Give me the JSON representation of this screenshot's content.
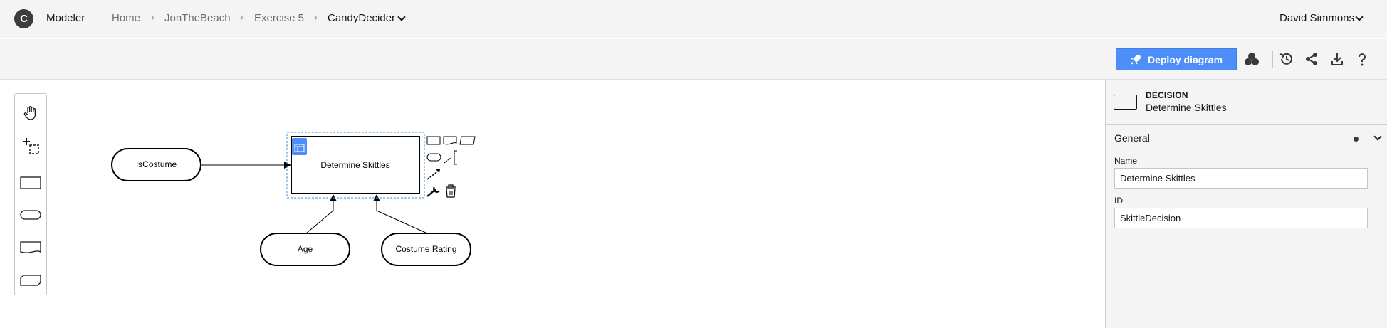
{
  "header": {
    "logo_letter": "C",
    "app_name": "Modeler",
    "breadcrumbs": [
      "Home",
      "JonTheBeach",
      "Exercise 5",
      "CandyDecider"
    ],
    "separator": "›",
    "user_name": "David Simmons"
  },
  "toolbar": {
    "deploy_label": "Deploy diagram",
    "icons": [
      "resources-icon",
      "history-icon",
      "share-icon",
      "download-icon",
      "help-icon"
    ],
    "accent_color": "#4d8ef8"
  },
  "palette": {
    "tools": [
      "hand-tool-icon",
      "lasso-tool-icon",
      "decision-shape-icon",
      "input-data-shape-icon",
      "knowledge-source-shape-icon",
      "business-knowledge-model-shape-icon"
    ]
  },
  "diagram": {
    "decision": {
      "label": "Determine Skittles"
    },
    "inputs": [
      {
        "label": "IsCostume"
      },
      {
        "label": "Age"
      },
      {
        "label": "Costume Rating"
      }
    ],
    "selection_color": "#3d8bd9",
    "decision_table_badge_color": "#4d8ef8"
  },
  "properties": {
    "element_type": "DECISION",
    "element_name": "Determine Skittles",
    "section_title": "General",
    "fields": [
      {
        "label": "Name",
        "value": "Determine Skittles"
      },
      {
        "label": "ID",
        "value": "SkittleDecision"
      }
    ]
  }
}
